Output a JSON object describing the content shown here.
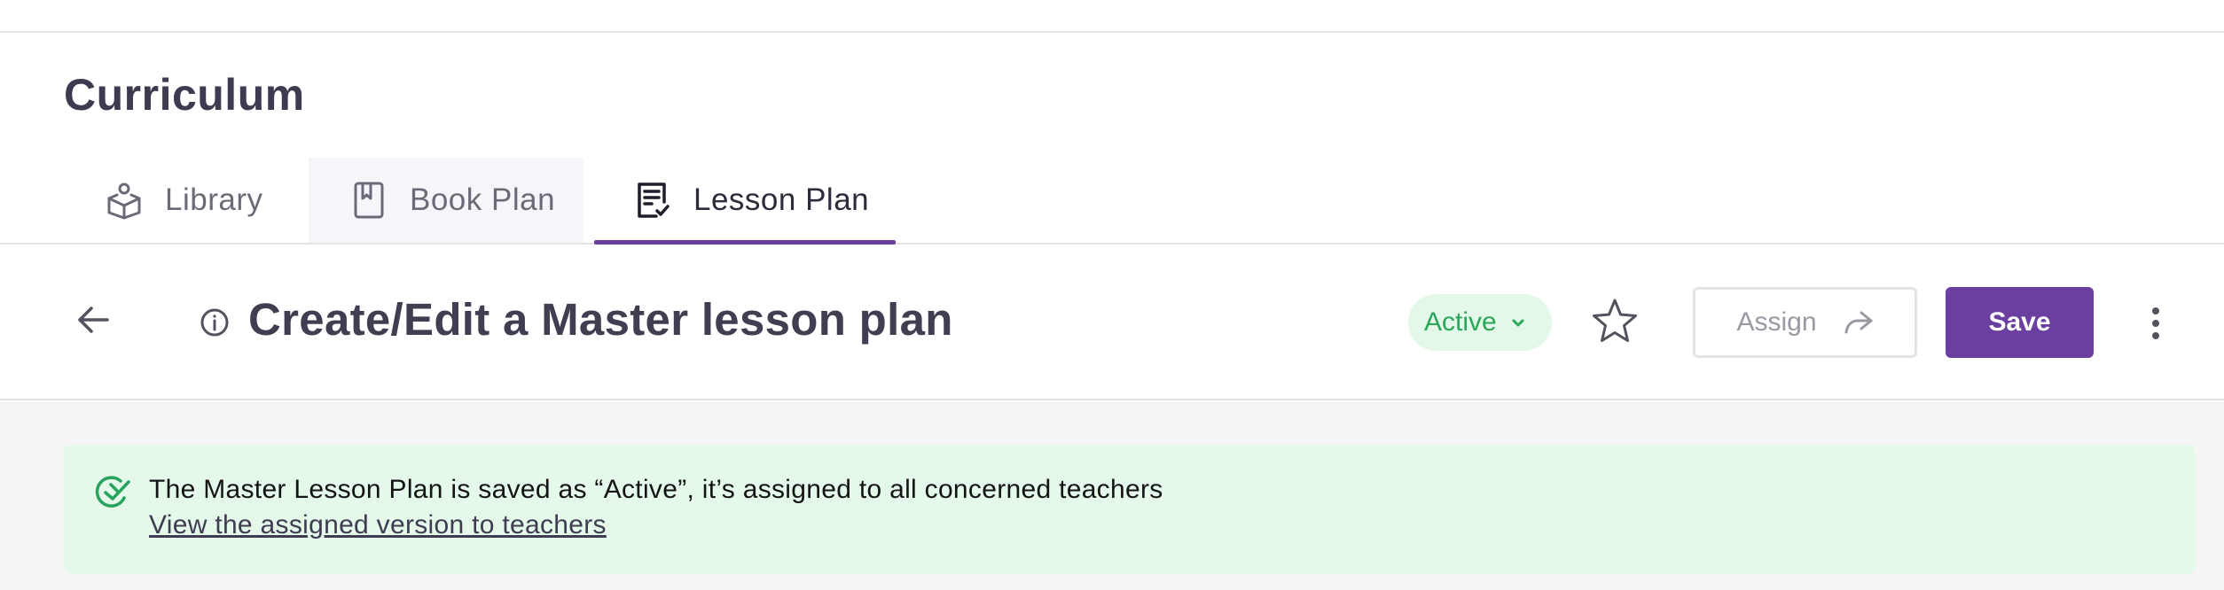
{
  "page": {
    "title": "Curriculum"
  },
  "tabs": [
    {
      "label": "Library",
      "icon": "library-icon",
      "active": false
    },
    {
      "label": "Book Plan",
      "icon": "bookmark-book-icon",
      "active": false
    },
    {
      "label": "Lesson Plan",
      "icon": "lesson-plan-icon",
      "active": true
    }
  ],
  "header": {
    "title": "Create/Edit a Master lesson plan",
    "status": "Active",
    "assign_label": "Assign",
    "save_label": "Save"
  },
  "notice": {
    "message": "The Master Lesson Plan is saved as “Active”, it’s assigned to all concerned teachers",
    "link": "View the assigned version to teachers"
  },
  "colors": {
    "accent": "#6b3fa0",
    "status_green": "#2aa75a",
    "status_bg": "#e4f8ea",
    "notice_bg": "#e4f9ea"
  }
}
